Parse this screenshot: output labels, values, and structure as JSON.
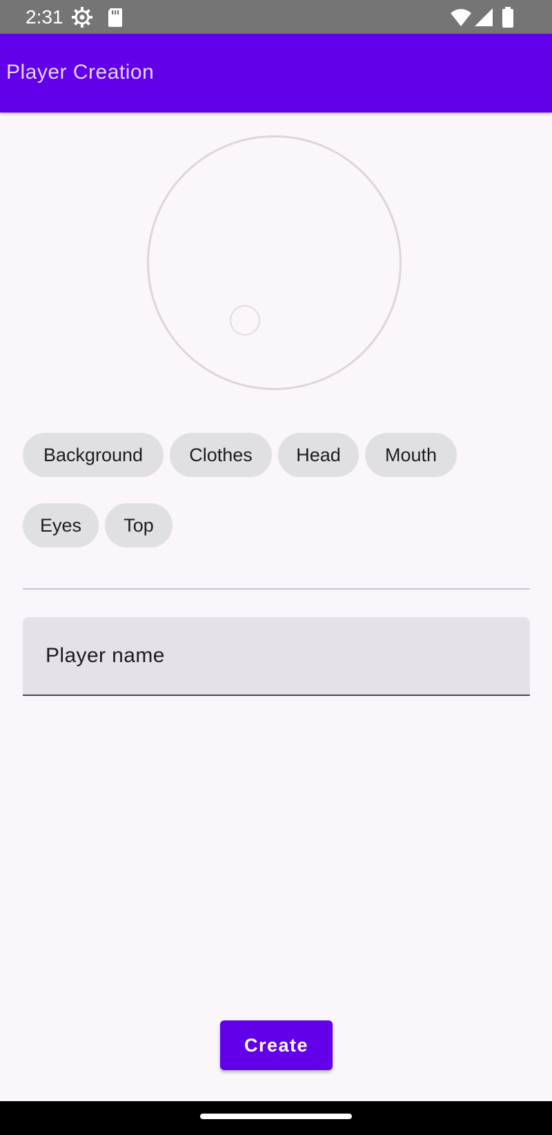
{
  "status_bar": {
    "time": "2:31",
    "icons": [
      "settings-icon",
      "sd-card-icon",
      "wifi-icon",
      "cell-signal-icon",
      "battery-icon"
    ]
  },
  "app_bar": {
    "title": "Player Creation",
    "background_color": "#6200ea",
    "title_color": "#e3d7ff"
  },
  "category_chips": [
    {
      "label": "Background"
    },
    {
      "label": "Clothes"
    },
    {
      "label": "Head"
    },
    {
      "label": "Mouth"
    },
    {
      "label": "Eyes"
    },
    {
      "label": "Top"
    }
  ],
  "player_name_field": {
    "label": "Player name",
    "value": ""
  },
  "create_button": {
    "label": "Create",
    "color": "#6200ea"
  }
}
